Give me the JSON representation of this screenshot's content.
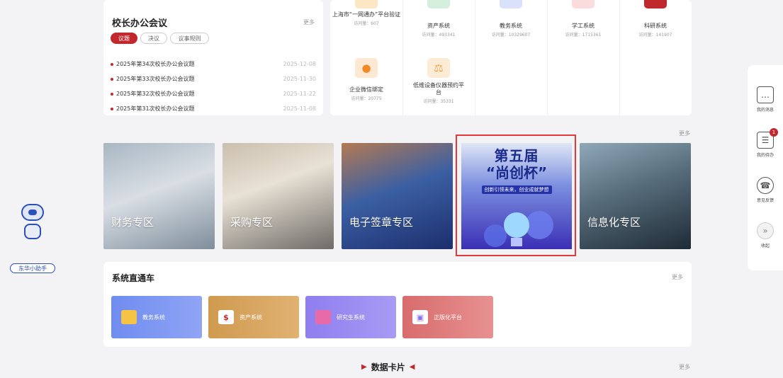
{
  "meeting": {
    "title": "校长办公会议",
    "more": "更多",
    "tabs": [
      "议题",
      "决议",
      "议事规则"
    ],
    "items": [
      {
        "title": "2025年第34次校长办公会议题",
        "date": "2025-12-08"
      },
      {
        "title": "2025年第33次校长办公会议题",
        "date": "2025-11-30"
      },
      {
        "title": "2025年第32次校长办公会议题",
        "date": "2025-11-22"
      },
      {
        "title": "2025年第31次校长办公会议题",
        "date": "2025-11-08"
      }
    ]
  },
  "systems": [
    {
      "name": "上海市“一网通办”平台验证",
      "count": "访问量：607",
      "icon": "network-icon",
      "color": "#f0b23a"
    },
    {
      "name": "资产系统",
      "count": "访问量：493341",
      "icon": "asset-icon",
      "color": "#2f9d5a"
    },
    {
      "name": "教务系统",
      "count": "访问量：10329607",
      "icon": "academic-icon",
      "color": "#3a62d6"
    },
    {
      "name": "学工系统",
      "count": "访问量：1715361",
      "icon": "student-icon",
      "color": "#d94d4d"
    },
    {
      "name": "科研系统",
      "count": "访问量：141907",
      "icon": "research-icon",
      "color": "#c0282e"
    },
    {
      "name": "企业微信绑定",
      "count": "访问量：20775",
      "icon": "wechat-icon",
      "color": "#f08a24"
    },
    {
      "name": "低维设备仪器预约平台",
      "count": "访问量：35331",
      "icon": "instrument-icon",
      "color": "#e6a64a"
    }
  ],
  "banners": {
    "more": "更多",
    "items": [
      {
        "label": "财务专区"
      },
      {
        "label": "采购专区"
      },
      {
        "label": "电子签章专区"
      },
      {
        "title1": "第五届",
        "title2": "“尚创杯”",
        "subtitle": "创新引领未来，创业成就梦想"
      },
      {
        "label": "信息化专区"
      }
    ]
  },
  "direct": {
    "title": "系统直通车",
    "more": "更多",
    "tiles": [
      "教务系统",
      "资产系统",
      "研究生系统",
      "正版化平台"
    ]
  },
  "data_card": {
    "title": "数据卡片",
    "more": "更多"
  },
  "assistant": {
    "label": "东华小助手"
  },
  "rail": {
    "items": [
      {
        "label": "我的消息"
      },
      {
        "label": "我的待办",
        "badge": "1"
      },
      {
        "label": "意见反馈"
      },
      {
        "label": "收起"
      }
    ]
  }
}
